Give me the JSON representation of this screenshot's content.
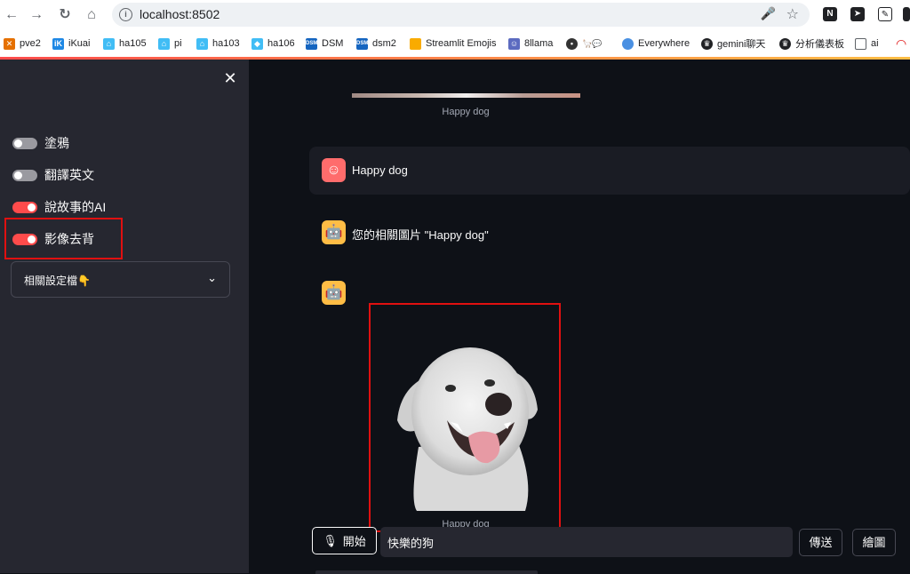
{
  "browser": {
    "url": "localhost:8502",
    "bookmarks": [
      {
        "label": "pve2",
        "icon": "pve-icon",
        "color": "#e57000"
      },
      {
        "label": "iKuai",
        "icon": "ikuai-icon",
        "color": "#1e88e5"
      },
      {
        "label": "ha105",
        "icon": "home-assistant-icon",
        "color": "#41bdf5"
      },
      {
        "label": "pi",
        "icon": "home-assistant-icon",
        "color": "#41bdf5"
      },
      {
        "label": "ha103",
        "icon": "home-assistant-icon",
        "color": "#41bdf5"
      },
      {
        "label": "ha106",
        "icon": "home-assistant-icon",
        "color": "#41bdf5"
      },
      {
        "label": "DSM",
        "icon": "dsm-icon",
        "color": "#1565c0"
      },
      {
        "label": "dsm2",
        "icon": "dsm-icon",
        "color": "#1565c0"
      },
      {
        "label": "Streamlit Emojis",
        "icon": "folder-icon",
        "color": "#f9ab00"
      },
      {
        "label": "8llama",
        "icon": "llama-icon",
        "color": "#5c6bc0"
      },
      {
        "label": "",
        "icon": "llama-chat-icon",
        "color": "#333333"
      },
      {
        "label": "Everywhere",
        "icon": "chat-bubble-icon",
        "color": "#4a90e2"
      },
      {
        "label": "gemini聊天",
        "icon": "crown-icon",
        "color": "#202124"
      },
      {
        "label": "分析儀表板",
        "icon": "crown-icon",
        "color": "#202124"
      },
      {
        "label": "ai",
        "icon": "folder-outline-icon",
        "color": "#5f6368"
      }
    ]
  },
  "sidebar": {
    "toggles": [
      {
        "label": "塗鴉",
        "on": false
      },
      {
        "label": "翻譯英文",
        "on": false
      },
      {
        "label": "說故事的AI",
        "on": true
      },
      {
        "label": "影像去背",
        "on": true
      }
    ],
    "expander_label": "相關設定檔👇"
  },
  "main": {
    "top_caption": "Happy dog",
    "user_message": "Happy dog",
    "bot_message": "您的相關圖片 \"Happy dog\"",
    "image_caption": "Happy dog",
    "start_label": "開始",
    "input_value": "快樂的狗",
    "send_label": "傳送",
    "draw_label": "繪圖"
  },
  "colors": {
    "accent": "#ff4b4b",
    "sidebar_bg": "#262730",
    "main_bg": "#0e1117",
    "bot_avatar": "#ffbd45",
    "user_avatar": "#ff6c6c"
  }
}
